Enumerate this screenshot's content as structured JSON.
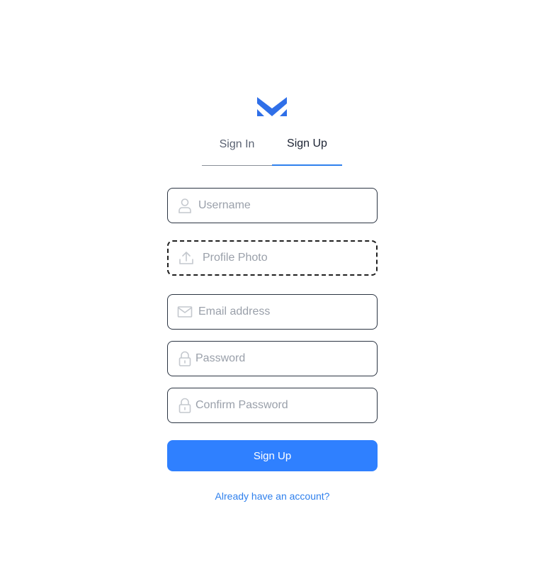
{
  "colors": {
    "accent": "#2f80ff",
    "logo": "#2f6fe8",
    "link": "#2f80ed"
  },
  "tabs": [
    {
      "label": "Sign In",
      "active": false
    },
    {
      "label": "Sign Up",
      "active": true
    }
  ],
  "form": {
    "username": {
      "placeholder": "Username",
      "value": "",
      "icon": "user-icon"
    },
    "profile_photo": {
      "label": "Profile Photo",
      "icon": "upload-icon"
    },
    "email": {
      "placeholder": "Email address",
      "value": "",
      "icon": "mail-icon"
    },
    "password": {
      "placeholder": "Password",
      "value": "",
      "icon": "lock-icon"
    },
    "confirm_password": {
      "placeholder": "Confirm Password",
      "value": "",
      "icon": "lock-icon"
    },
    "submit_label": "Sign Up",
    "login_link": "Already have an account?"
  }
}
